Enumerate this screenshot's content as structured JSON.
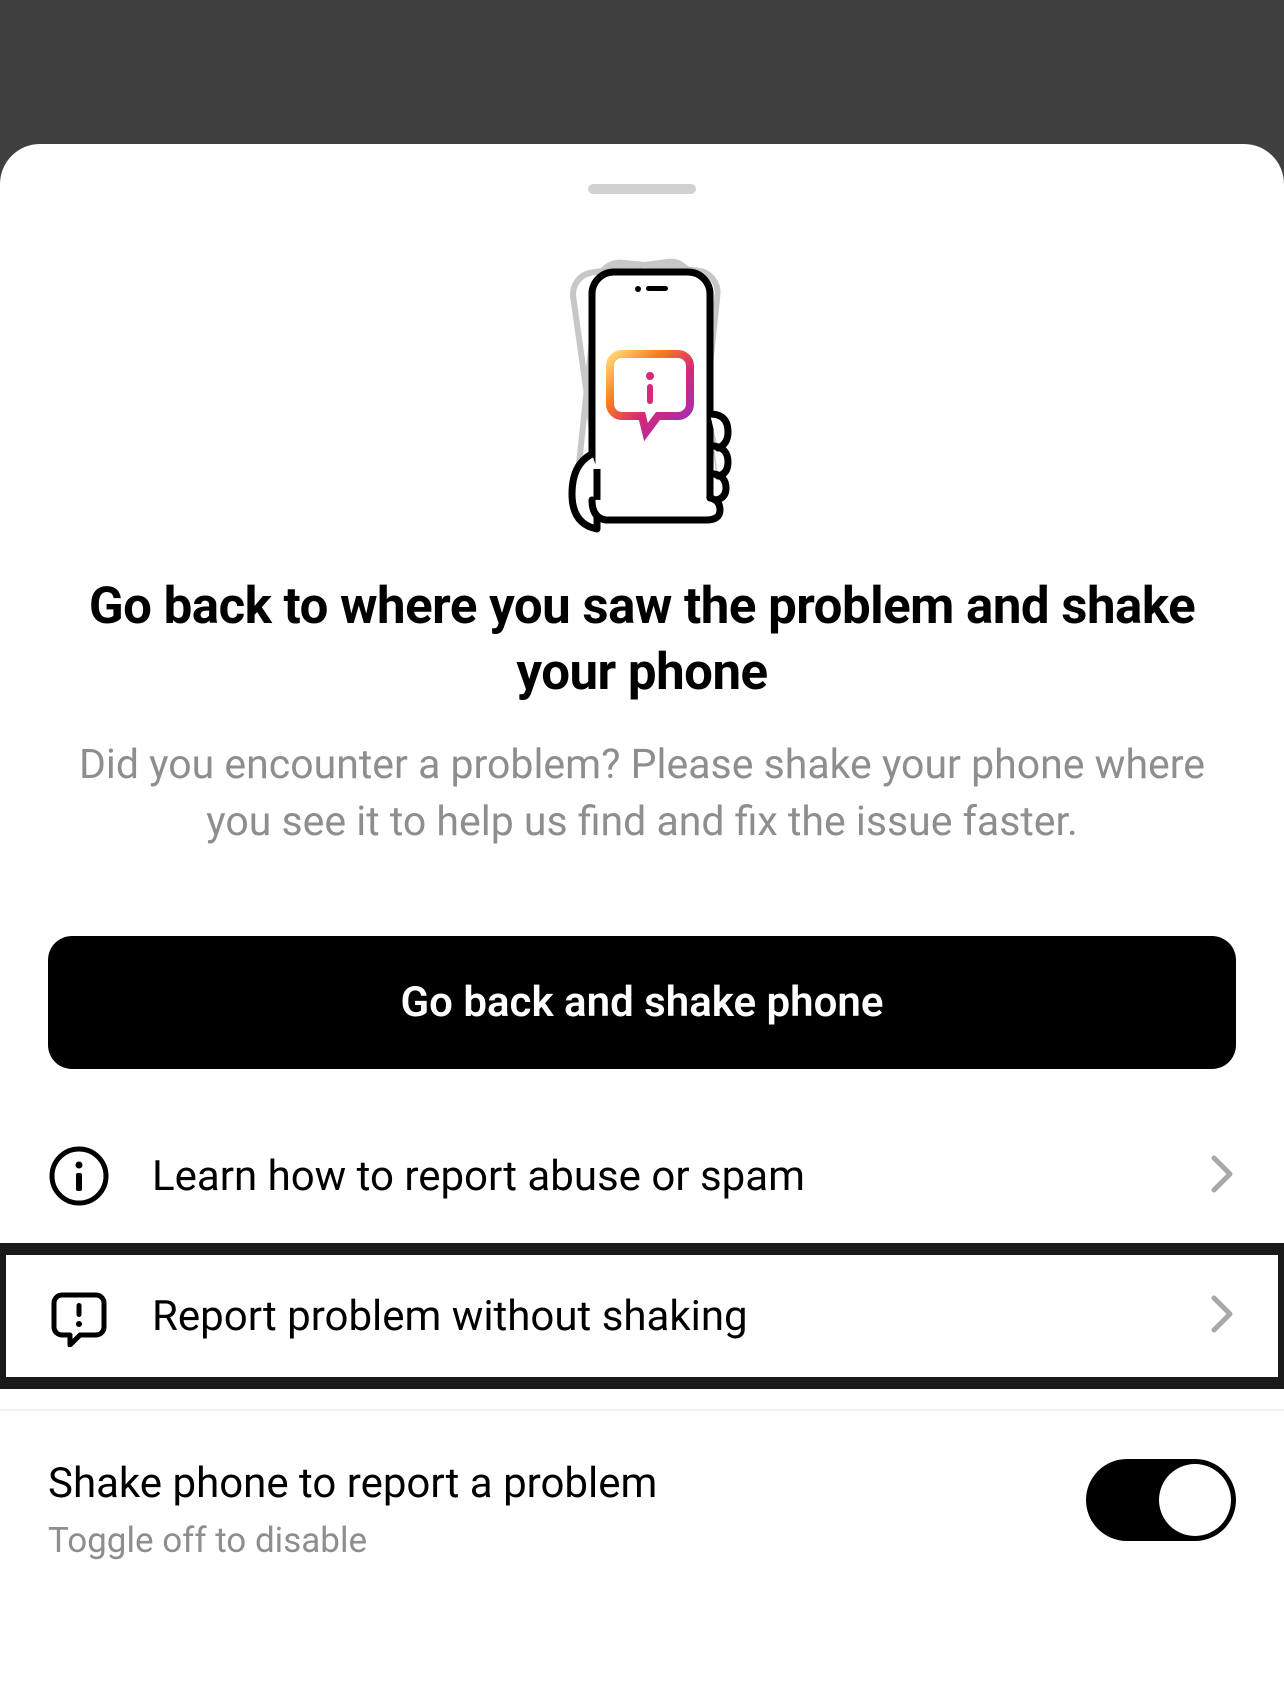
{
  "heading": "Go back to where you saw the problem and shake your phone",
  "description": "Did you encounter a problem? Please shake your phone where you see it to help us find and fix the issue faster.",
  "primaryButton": "Go back and shake phone",
  "links": {
    "learnAbuse": "Learn how to report abuse or spam",
    "reportWithoutShaking": "Report problem without shaking"
  },
  "toggle": {
    "title": "Shake phone to report a problem",
    "subtitle": "Toggle off to disable",
    "enabled": true
  }
}
